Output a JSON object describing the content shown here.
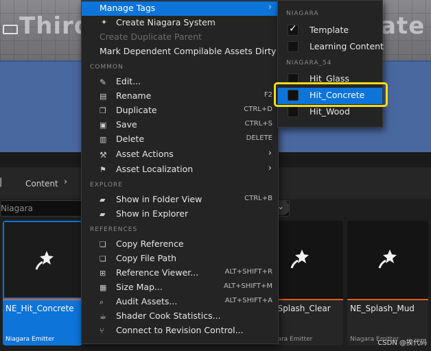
{
  "viewport": {
    "banner_left": "Third",
    "banner_right": "ate"
  },
  "breadcrumb": {
    "items": [
      "Content"
    ]
  },
  "search": {
    "value": "Niagara"
  },
  "tiles": [
    {
      "name": "NE_Hit_Concrete",
      "type": "Niagara Emitter"
    },
    {
      "name": "NE_Splash_Clear",
      "type": "Niagara Emitter"
    },
    {
      "name": "NE_Splash_Mud",
      "type": "Niagara Emitter"
    }
  ],
  "menu": {
    "manage_tags": "Manage Tags",
    "create_niagara_system": "Create Niagara System",
    "create_duplicate_parent": "Create Duplicate Parent",
    "mark_dependent": "Mark Dependent Compilable Assets Dirty",
    "sections": {
      "common": "COMMON",
      "explore": "EXPLORE",
      "references": "REFERENCES"
    },
    "common": [
      {
        "label": "Edit...",
        "shortcut": "",
        "icon": "pencil-icon"
      },
      {
        "label": "Rename",
        "shortcut": "F2",
        "icon": "rename-icon"
      },
      {
        "label": "Duplicate",
        "shortcut": "CTRL+D",
        "icon": "duplicate-icon"
      },
      {
        "label": "Save",
        "shortcut": "CTRL+S",
        "icon": "save-icon"
      },
      {
        "label": "Delete",
        "shortcut": "DELETE",
        "icon": "trash-icon"
      },
      {
        "label": "Asset Actions",
        "shortcut": "",
        "icon": "wrench-icon"
      },
      {
        "label": "Asset Localization",
        "shortcut": "",
        "icon": "flag-icon"
      }
    ],
    "explore": [
      {
        "label": "Show in Folder View",
        "shortcut": "CTRL+B",
        "icon": "folder-search-icon"
      },
      {
        "label": "Show in Explorer",
        "shortcut": "",
        "icon": "folder-search-icon"
      }
    ],
    "references": [
      {
        "label": "Copy Reference",
        "shortcut": "",
        "icon": "copy-icon"
      },
      {
        "label": "Copy File Path",
        "shortcut": "",
        "icon": "copy-icon"
      },
      {
        "label": "Reference Viewer...",
        "shortcut": "ALT+SHIFT+R",
        "icon": "reference-viewer-icon"
      },
      {
        "label": "Size Map...",
        "shortcut": "ALT+SHIFT+M",
        "icon": "size-map-icon"
      },
      {
        "label": "Audit Assets...",
        "shortcut": "ALT+SHIFT+A",
        "icon": "audit-icon"
      },
      {
        "label": "Shader Cook Statistics...",
        "shortcut": "",
        "icon": "stats-icon"
      },
      {
        "label": "Connect to Revision Control...",
        "shortcut": "",
        "icon": "revision-icon"
      }
    ]
  },
  "submenu": {
    "section_niagara": "NIAGARA",
    "section_niagara54": "NIAGARA_54",
    "niagara_items": [
      {
        "label": "Template",
        "checked": true
      },
      {
        "label": "Learning Content",
        "checked": false
      }
    ],
    "niagara54_items": [
      {
        "label": "Hit_Glass",
        "checked": false
      },
      {
        "label": "Hit_Concrete",
        "checked": false
      },
      {
        "label": "Hit_Wood",
        "checked": false
      }
    ]
  },
  "watermark": "CSDN @挨代码",
  "colors": {
    "accent": "#0d74d9",
    "highlight_ring": "#f2de1c",
    "asset_bar": "#e35e1c"
  }
}
